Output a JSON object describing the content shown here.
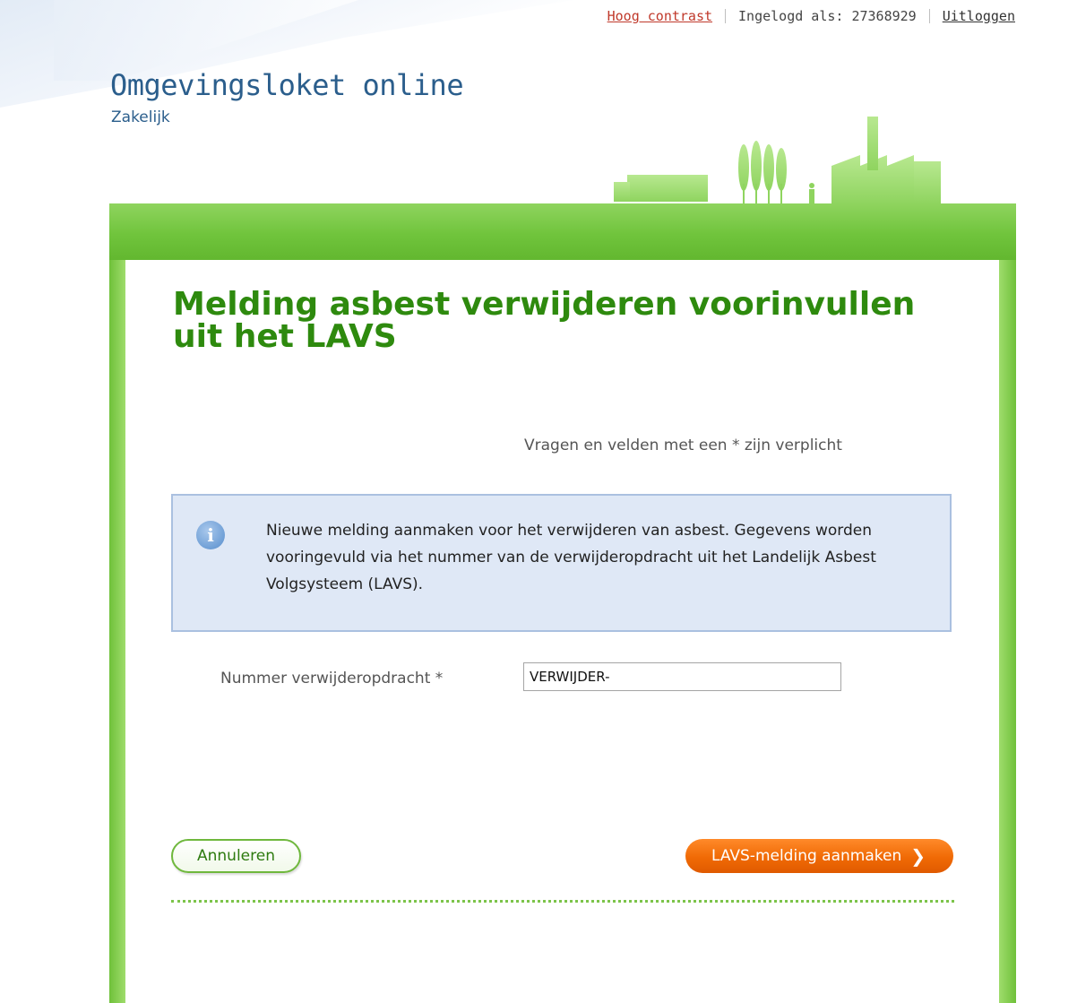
{
  "topbar": {
    "high_contrast_link": "Hoog contrast",
    "logged_in_as": "Ingelogd als: 27368929",
    "logout_link": "Uitloggen"
  },
  "brand": {
    "title": "Omgevingsloket online",
    "subtitle": "Zakelijk"
  },
  "page": {
    "title": "Melding asbest verwijderen voorinvullen uit het LAVS",
    "required_note": "Vragen en velden met een * zijn verplicht"
  },
  "info": {
    "icon": "info-icon",
    "text": "Nieuwe melding aanmaken voor het verwijderen van asbest. Gegevens worden vooringevuld via het nummer van de verwijderopdracht uit het Landelijk Asbest Volgsysteem (LAVS)."
  },
  "form": {
    "field_label": "Nummer verwijderopdracht *",
    "field_value": "VERWIJDER-"
  },
  "actions": {
    "cancel_label": "Annuleren",
    "submit_label": "LAVS-melding aanmaken",
    "submit_chevron": "❯"
  },
  "colors": {
    "accent_green": "#2e8a0e",
    "frame_green": "#70c43c",
    "primary_orange": "#f06a05",
    "brand_blue": "#2b5e8c",
    "info_bg": "#dfe8f6"
  }
}
